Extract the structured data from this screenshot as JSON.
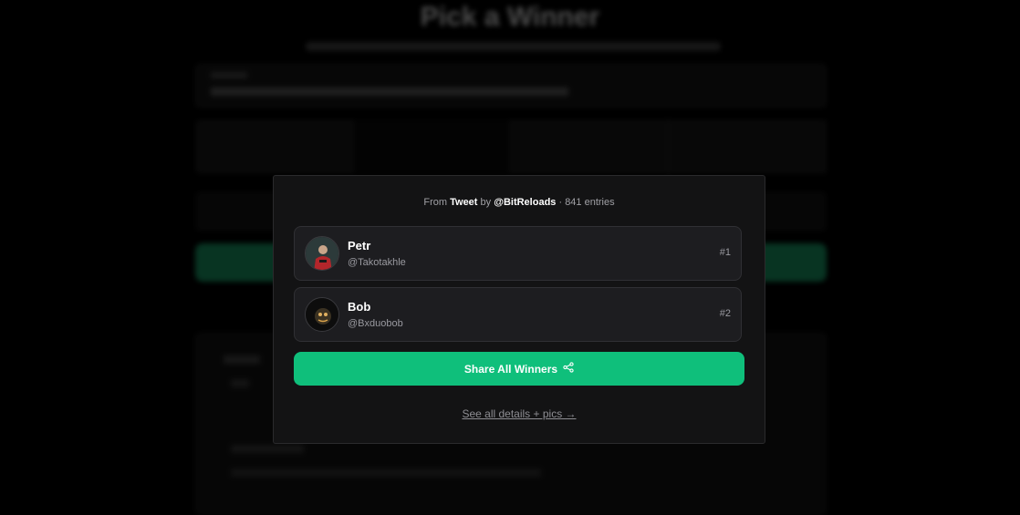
{
  "background": {
    "title": "Pick a Winner"
  },
  "modal": {
    "source_prefix": "From",
    "source_type": "Tweet",
    "source_by": "by",
    "source_author": "@BitReloads",
    "source_entries": "· 841 entries",
    "winners": [
      {
        "name": "Petr",
        "handle": "@Takotakhle",
        "rank": "#1"
      },
      {
        "name": "Bob",
        "handle": "@Bxduobob",
        "rank": "#2"
      }
    ],
    "share_label": "Share All Winners",
    "share_icon": "share-icon",
    "details_label": "See all details + pics →"
  },
  "colors": {
    "accent": "#0fbf7b",
    "modal_bg": "#131314",
    "card_bg": "#1d1d20"
  }
}
